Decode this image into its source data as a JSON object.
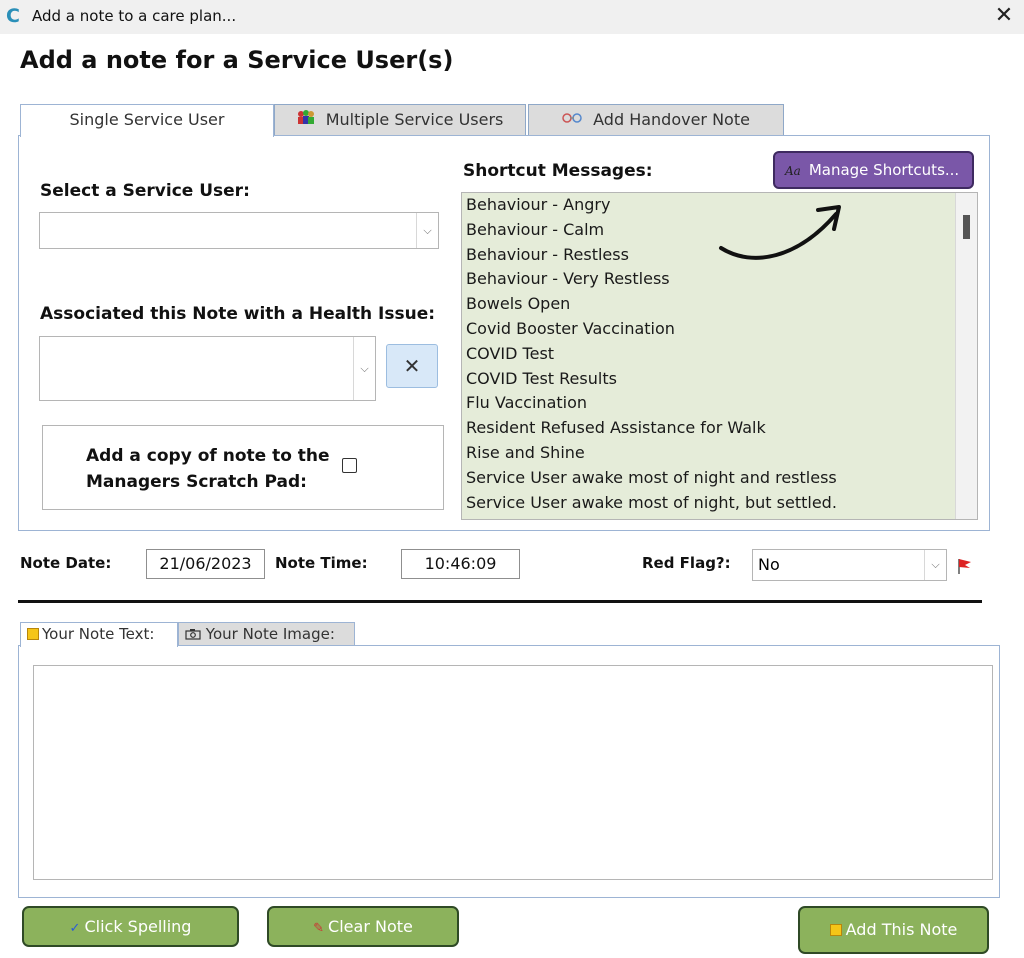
{
  "window": {
    "title": "Add a note to a care plan...",
    "logo_letter": "C",
    "close_glyph": "✕"
  },
  "page_title": "Add a note for a Service User(s)",
  "tabs": [
    {
      "label": "Single Service User",
      "active": true
    },
    {
      "label": "Multiple Service Users",
      "icon": "people-icon",
      "active": false
    },
    {
      "label": "Add Handover Note",
      "icon": "handover-icon",
      "active": false
    }
  ],
  "form": {
    "select_user_label": "Select a Service User:",
    "select_user_value": "",
    "health_issue_label": "Associated this Note with a Health Issue:",
    "health_issue_value": "",
    "clear_glyph": "✕",
    "copy_label": "Add a copy of note to the Managers Scratch Pad:",
    "copy_checked": false
  },
  "shortcuts": {
    "label": "Shortcut Messages:",
    "manage_label": "Manage Shortcuts...",
    "manage_icon_text": "Aa",
    "items": [
      "Behaviour - Angry",
      "Behaviour - Calm",
      "Behaviour - Restless",
      "Behaviour - Very Restless",
      "Bowels Open",
      "Covid Booster Vaccination",
      "COVID Test",
      "COVID Test Results",
      "Flu Vaccination",
      "Resident Refused Assistance for Walk",
      "Rise and Shine",
      "Service User awake most of night and restless",
      "Service User awake most of night, but settled."
    ]
  },
  "note_meta": {
    "date_label": "Note Date:",
    "date_value": "21/06/2023",
    "time_label": "Note Time:",
    "time_value": "10:46:09",
    "red_flag_label": "Red Flag?:",
    "red_flag_value": "No"
  },
  "note_tabs": [
    {
      "label": "Your Note Text:",
      "icon": "note-icon",
      "active": true
    },
    {
      "label": "Your Note Image:",
      "icon": "camera-icon",
      "active": false
    }
  ],
  "note_text": "",
  "buttons": {
    "spelling": "Click Spelling",
    "clear": "Clear Note",
    "add": "Add This Note"
  },
  "colors": {
    "accent_purple": "#7a57a8",
    "button_green": "#8cb25c",
    "list_bg": "#e5ecd9"
  }
}
